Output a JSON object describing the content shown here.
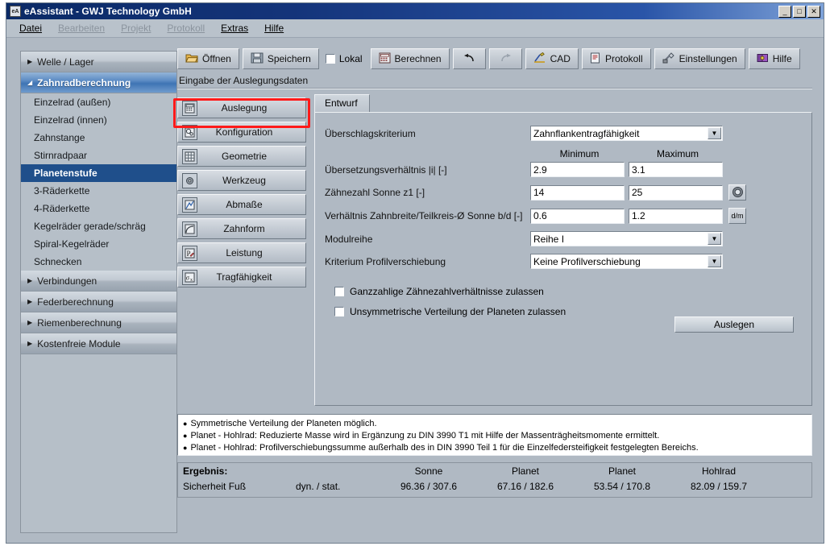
{
  "window": {
    "title": "eAssistant - GWJ Technology GmbH",
    "icon": "app-icon",
    "controls": {
      "minimize": "_",
      "maximize": "□",
      "close": "✕"
    }
  },
  "menu": [
    {
      "label": "Datei",
      "mnemonic": "D",
      "disabled": false
    },
    {
      "label": "Bearbeiten",
      "mnemonic": "B",
      "disabled": true
    },
    {
      "label": "Projekt",
      "mnemonic": "P",
      "disabled": true
    },
    {
      "label": "Protokoll",
      "mnemonic": "r",
      "disabled": true
    },
    {
      "label": "Extras",
      "mnemonic": "x",
      "disabled": false
    },
    {
      "label": "Hilfe",
      "mnemonic": "H",
      "disabled": false
    }
  ],
  "sidebar": {
    "groups": [
      {
        "label": "Welle / Lager",
        "expanded": false,
        "arrow": "▶"
      },
      {
        "label": "Zahnradberechnung",
        "expanded": true,
        "arrow": "◢",
        "items": [
          {
            "label": "Einzelrad (außen)",
            "selected": false
          },
          {
            "label": "Einzelrad (innen)",
            "selected": false
          },
          {
            "label": "Zahnstange",
            "selected": false
          },
          {
            "label": "Stirnradpaar",
            "selected": false
          },
          {
            "label": "Planetenstufe",
            "selected": true
          },
          {
            "label": "3-Räderkette",
            "selected": false
          },
          {
            "label": "4-Räderkette",
            "selected": false
          },
          {
            "label": "Kegelräder gerade/schräg",
            "selected": false
          },
          {
            "label": "Spiral-Kegelräder",
            "selected": false
          },
          {
            "label": "Schnecken",
            "selected": false
          }
        ]
      },
      {
        "label": "Verbindungen",
        "expanded": false,
        "arrow": "▶"
      },
      {
        "label": "Federberechnung",
        "expanded": false,
        "arrow": "▶"
      },
      {
        "label": "Riemenberechnung",
        "expanded": false,
        "arrow": "▶"
      },
      {
        "label": "Kostenfreie Module",
        "expanded": false,
        "arrow": "▶"
      }
    ]
  },
  "toolbar": {
    "open_label": "Öffnen",
    "open_icon": "open-folder-icon",
    "save_label": "Speichern",
    "save_icon": "floppy-disk-icon",
    "local_label": "Lokal",
    "local_checked": false,
    "calculate_label": "Berechnen",
    "calculate_icon": "calculator-icon",
    "undo_icon": "undo-arrow-icon",
    "redo_icon": "redo-arrow-icon",
    "cad_label": "CAD",
    "cad_icon": "cad-pencil-icon",
    "protocol_label": "Protokoll",
    "protocol_icon": "document-icon",
    "settings_label": "Einstellungen",
    "settings_icon": "tools-icon",
    "help_label": "Hilfe",
    "help_icon": "book-icon"
  },
  "section": {
    "title": "Eingabe der Auslegungsdaten"
  },
  "vtabs": [
    {
      "label": "Auslegung",
      "icon": "calculator-icon",
      "glyph": "▦",
      "active": true
    },
    {
      "label": "Konfiguration",
      "icon": "gears-icon",
      "glyph": "⚙",
      "active": false
    },
    {
      "label": "Geometrie",
      "icon": "grid-icon",
      "glyph": "▦",
      "active": false
    },
    {
      "label": "Werkzeug",
      "icon": "tool-gear-icon",
      "glyph": "✾",
      "active": false
    },
    {
      "label": "Abmaße",
      "icon": "chart-icon",
      "glyph": "◪",
      "active": false
    },
    {
      "label": "Zahnform",
      "icon": "tooth-profile-icon",
      "glyph": "◴",
      "active": false
    },
    {
      "label": "Leistung",
      "icon": "power-pencil-icon",
      "glyph": "℞",
      "active": false
    },
    {
      "label": "Tragfähigkeit",
      "icon": "sigma-x-icon",
      "glyph": "σₓ",
      "active": false
    }
  ],
  "tabs": [
    {
      "label": "Entwurf",
      "active": true
    }
  ],
  "form": {
    "column_headers": {
      "minimum": "Minimum",
      "maximum": "Maximum"
    },
    "criterion": {
      "label": "Überschlagskriterium",
      "value": "Zahnflankentragfähigkeit"
    },
    "ratio": {
      "label": "Übersetzungsverhältnis |i| [-]",
      "min": "2.9",
      "max": "3.1"
    },
    "teeth": {
      "label": "Zähnezahl Sonne z1 [-]",
      "min": "14",
      "max": "25",
      "side_button_icon": "gear-wheel-icon"
    },
    "width": {
      "label": "Verhältnis Zahnbreite/Teilkreis-Ø Sonne b/d [-]",
      "min": "0.6",
      "max": "1.2",
      "side_button_label": "d/m"
    },
    "module": {
      "label": "Modulreihe",
      "value": "Reihe I"
    },
    "profile": {
      "label": "Kriterium Profilverschiebung",
      "value": "Keine Profilverschiebung"
    },
    "checkboxes": [
      {
        "label": "Ganzzahlige Zähnezahlverhältnisse zulassen",
        "checked": false
      },
      {
        "label": "Unsymmetrische Verteilung der Planeten zulassen",
        "checked": false
      }
    ],
    "design_button": "Auslegen"
  },
  "messages": [
    "Symmetrische Verteilung der Planeten möglich.",
    "Planet - Hohlrad: Reduzierte Masse wird in Ergänzung zu DIN 3990 T1 mit Hilfe der Massenträgheitsmomente ermittelt.",
    "Planet - Hohlrad: Profilverschiebungssumme außerhalb des in DIN 3990 Teil 1 für die Einzelfedersteifigkeit festgelegten Bereichs."
  ],
  "results": {
    "title": "Ergebnis:",
    "columns": [
      "Sonne",
      "Planet",
      "Planet",
      "Hohlrad"
    ],
    "row_label": "Sicherheit Fuß",
    "row_unit": "dyn. / stat.",
    "values": [
      "96.36  /   307.6",
      "67.16  /  182.6",
      "53.54  /  170.8",
      "82.09  /  159.7"
    ]
  },
  "annotation": {
    "color": "#ff1a1a",
    "target": "Auslegung"
  }
}
